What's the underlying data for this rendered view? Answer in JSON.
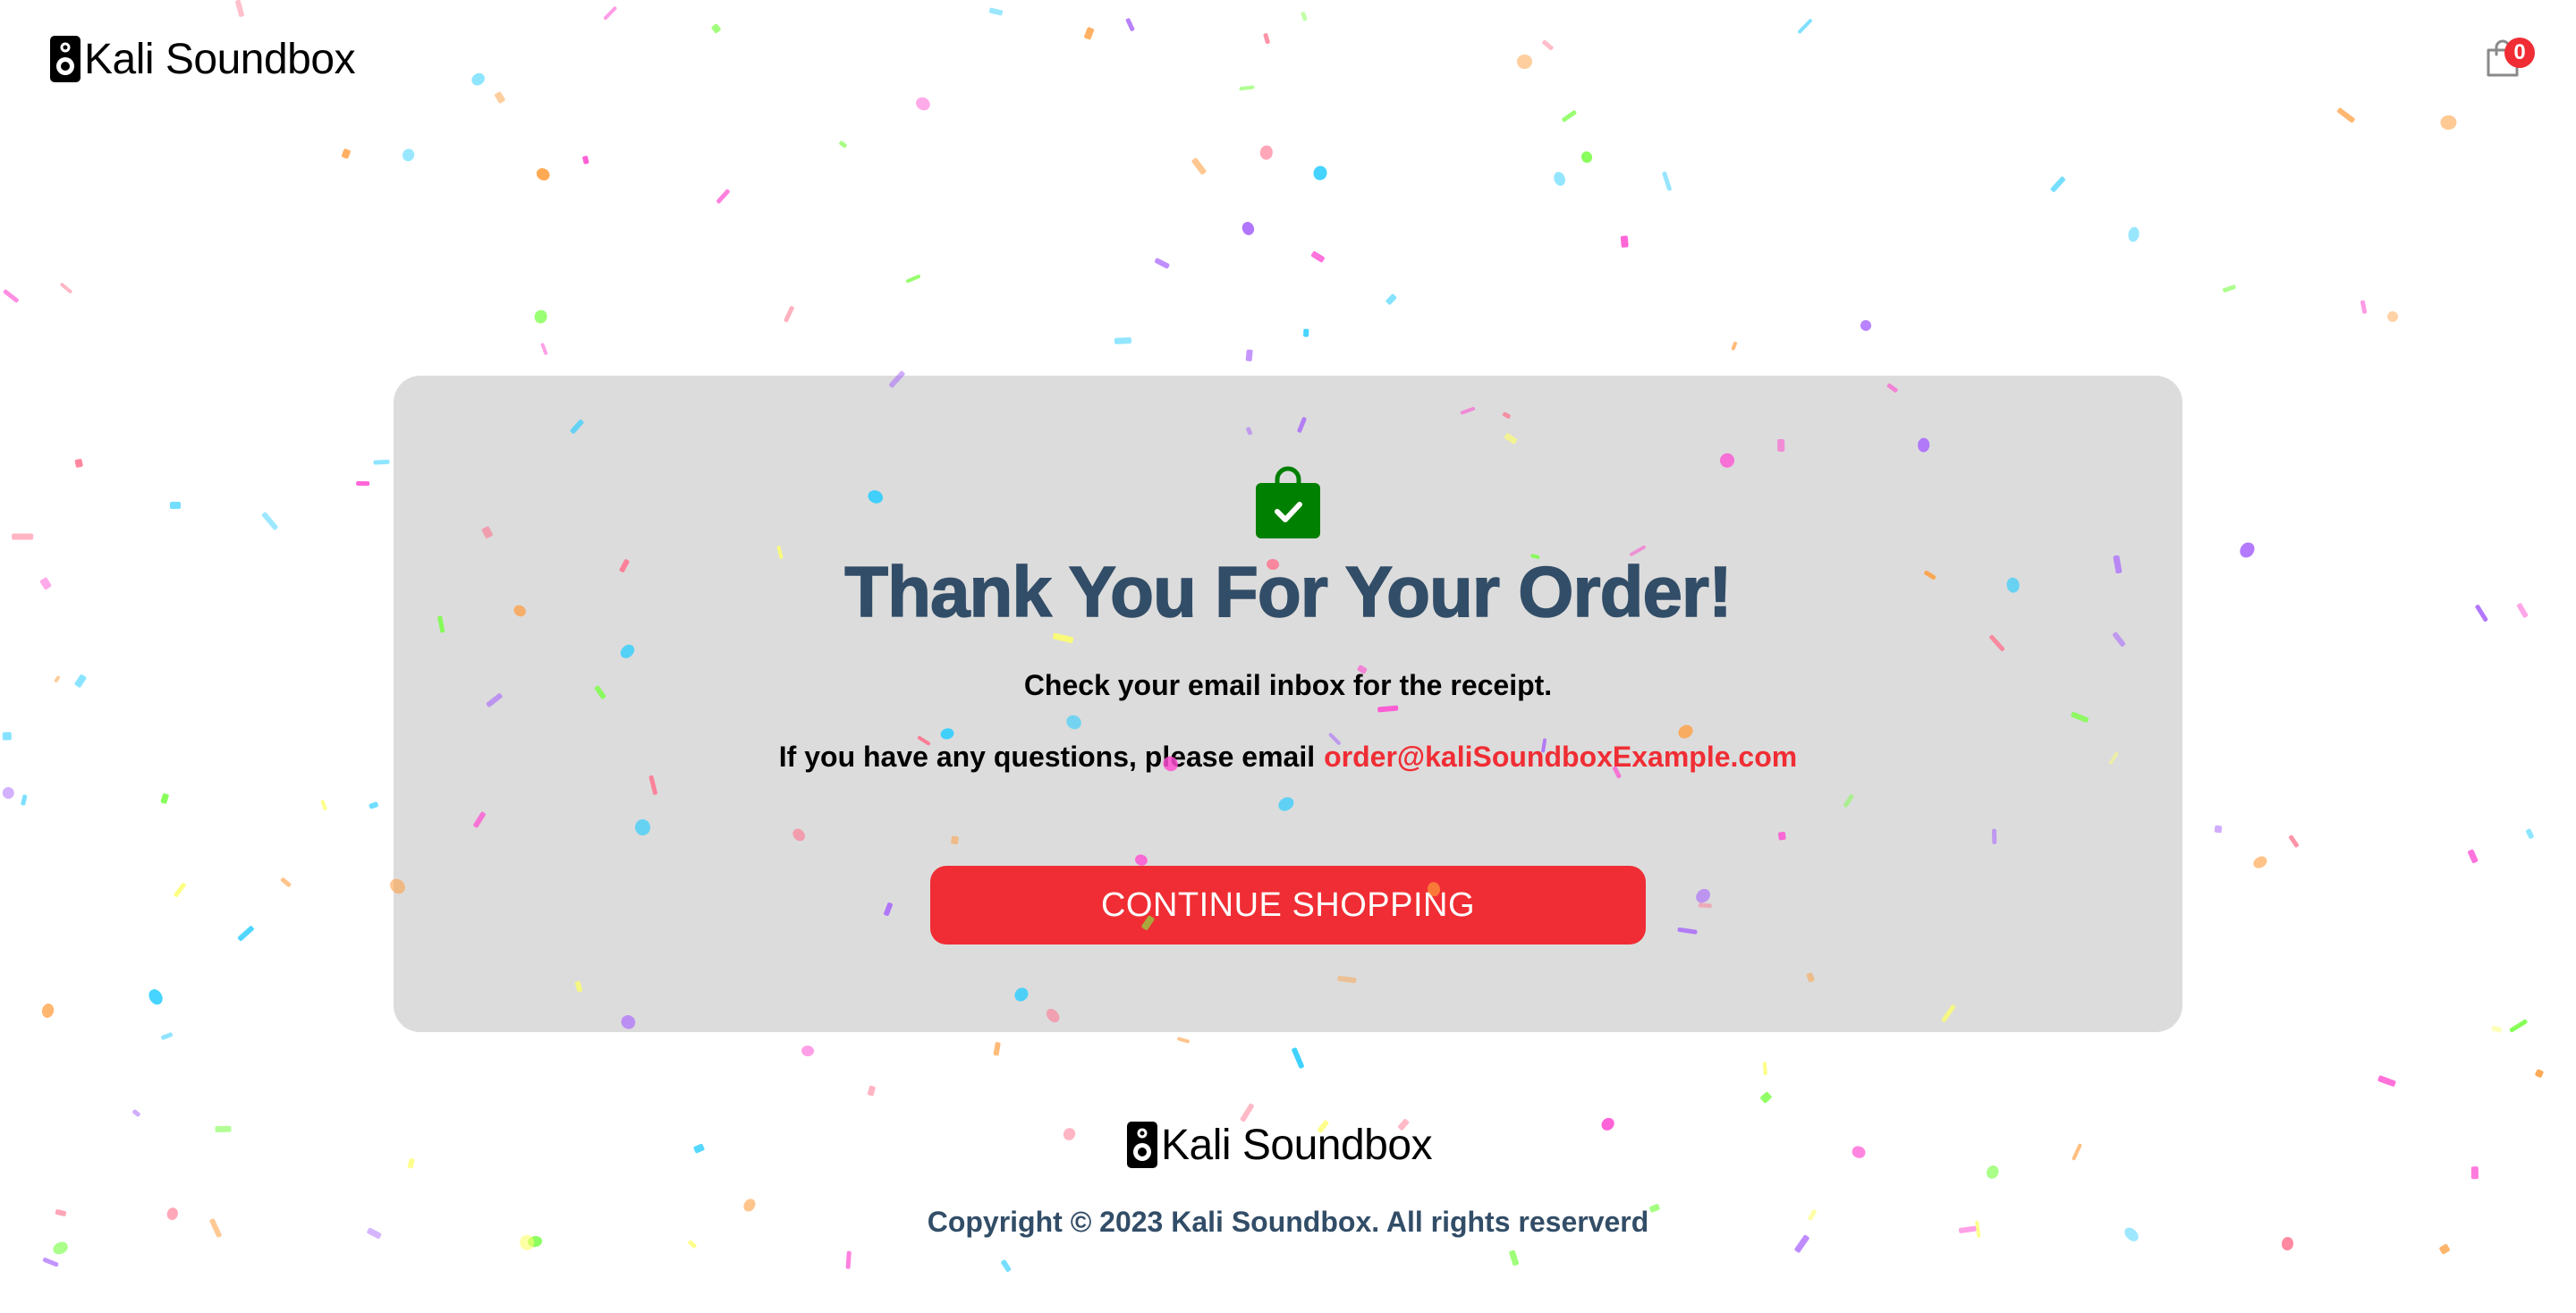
{
  "header": {
    "logo_text": "Kali Soundbox",
    "cart_count": "0"
  },
  "success": {
    "title": "Thank You For Your Order!",
    "email_message": "Check your email inbox for the receipt.",
    "question_text": "If you have any questions, please email",
    "contact_email": "order@kaliSoundboxExample.com",
    "button_label": "CONTINUE SHOPPING"
  },
  "footer": {
    "logo_text": "Kali Soundbox",
    "copyright": "Copyright © 2023 Kali Soundbox. All rights reserverd"
  },
  "colors": {
    "accent": "#f02d34",
    "heading": "#324d67",
    "card_background": "#dcdcdc",
    "bag_icon": "#008000"
  },
  "icons": {
    "logo": "speaker-icon",
    "cart": "shopping-bag-icon",
    "success": "bag-check-icon"
  }
}
